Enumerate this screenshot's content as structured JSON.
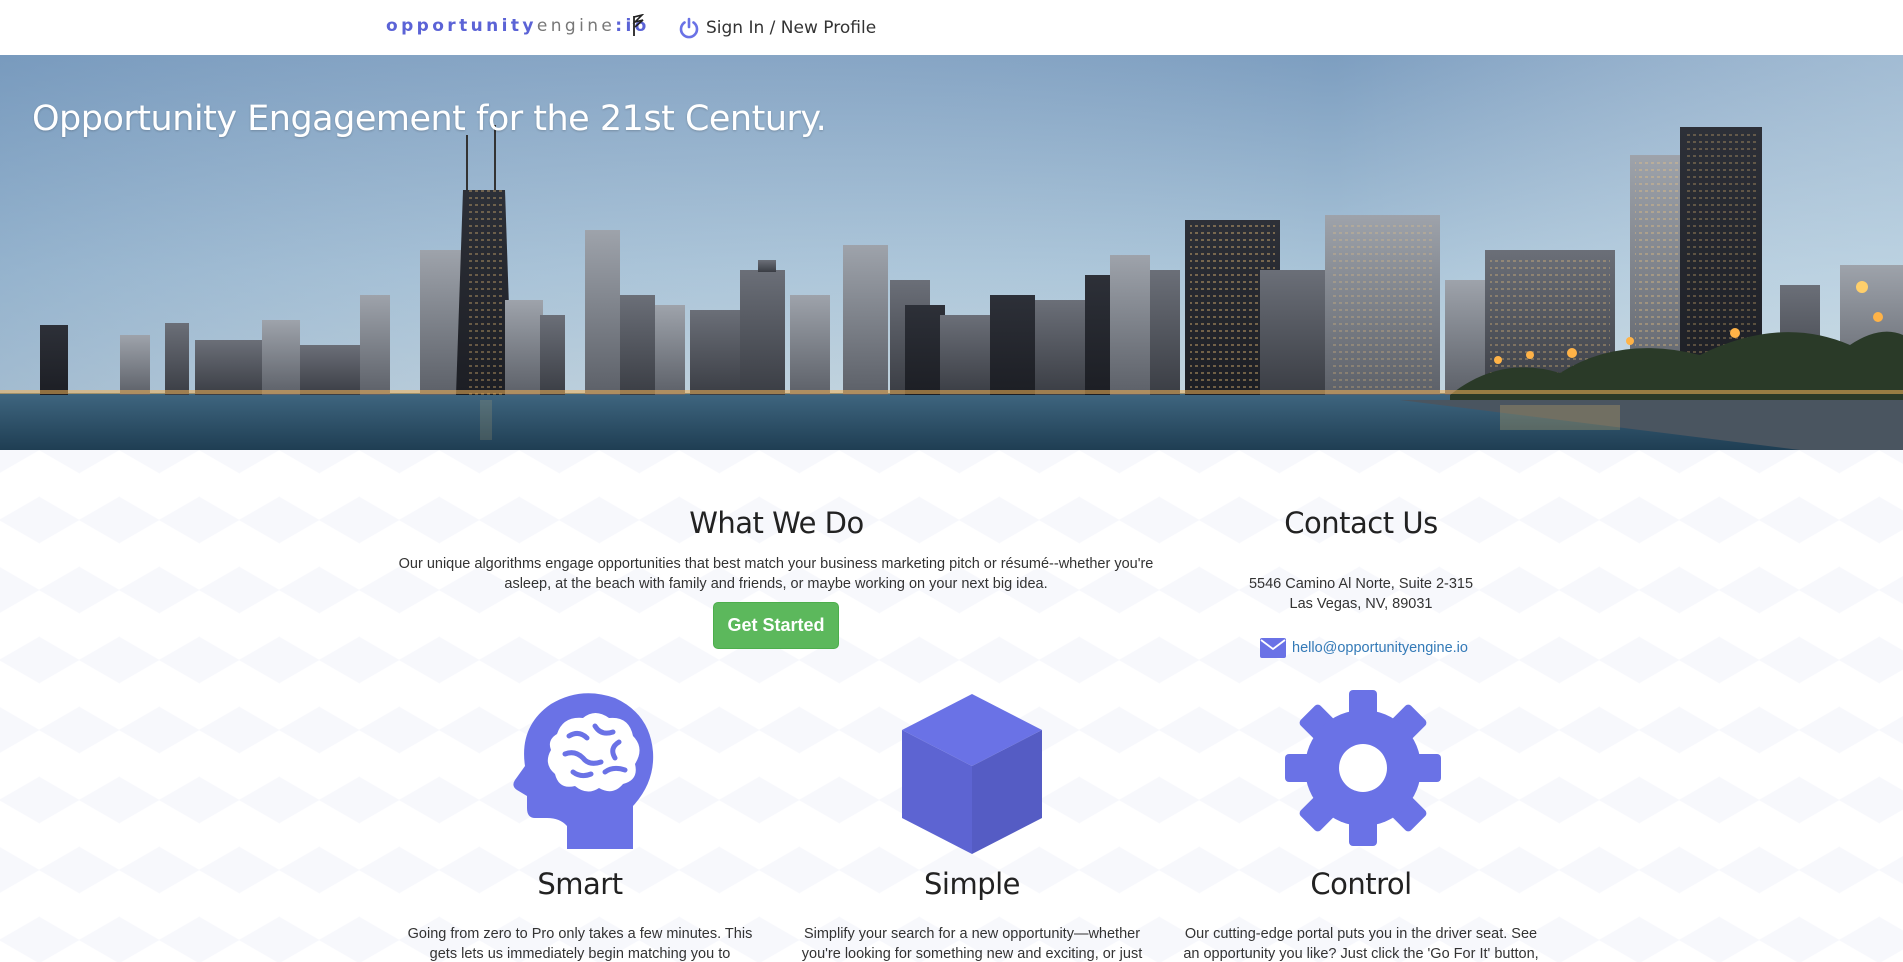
{
  "header": {
    "logo": {
      "part_a": "opportunity",
      "part_b": "engine",
      "part_c": ":io"
    },
    "signin_label": "Sign In / New Profile"
  },
  "hero": {
    "title": "Opportunity Engagement for the 21st Century."
  },
  "what_we_do": {
    "title": "What We Do",
    "line1": "Our unique algorithms engage opportunities that best match your business marketing pitch or résumé--whether you're",
    "line2": "asleep, at the beach with family and friends, or maybe working on your next big idea.",
    "button_label": "Get Started"
  },
  "contact": {
    "title": "Contact Us",
    "address_line1": "5546 Camino Al Norte, Suite 2-315",
    "address_line2": "Las Vegas, NV, 89031",
    "email": "hello@opportunityengine.io"
  },
  "features": [
    {
      "icon": "brain-head-icon",
      "title": "Smart",
      "line1": "Going from zero to Pro only takes a few minutes. This",
      "line2": "gets lets us immediately begin matching you to"
    },
    {
      "icon": "cube-icon",
      "title": "Simple",
      "line1": "Simplify your search for a new opportunity—whether",
      "line2": "you're looking for something new and exciting, or just"
    },
    {
      "icon": "gear-icon",
      "title": "Control",
      "line1": "Our cutting-edge portal puts you in the driver seat. See",
      "line2": "an opportunity you like? Just click the 'Go For It' button,"
    }
  ],
  "colors": {
    "accent": "#6a72e6",
    "button_green": "#5cb85c",
    "link": "#337ab7"
  }
}
